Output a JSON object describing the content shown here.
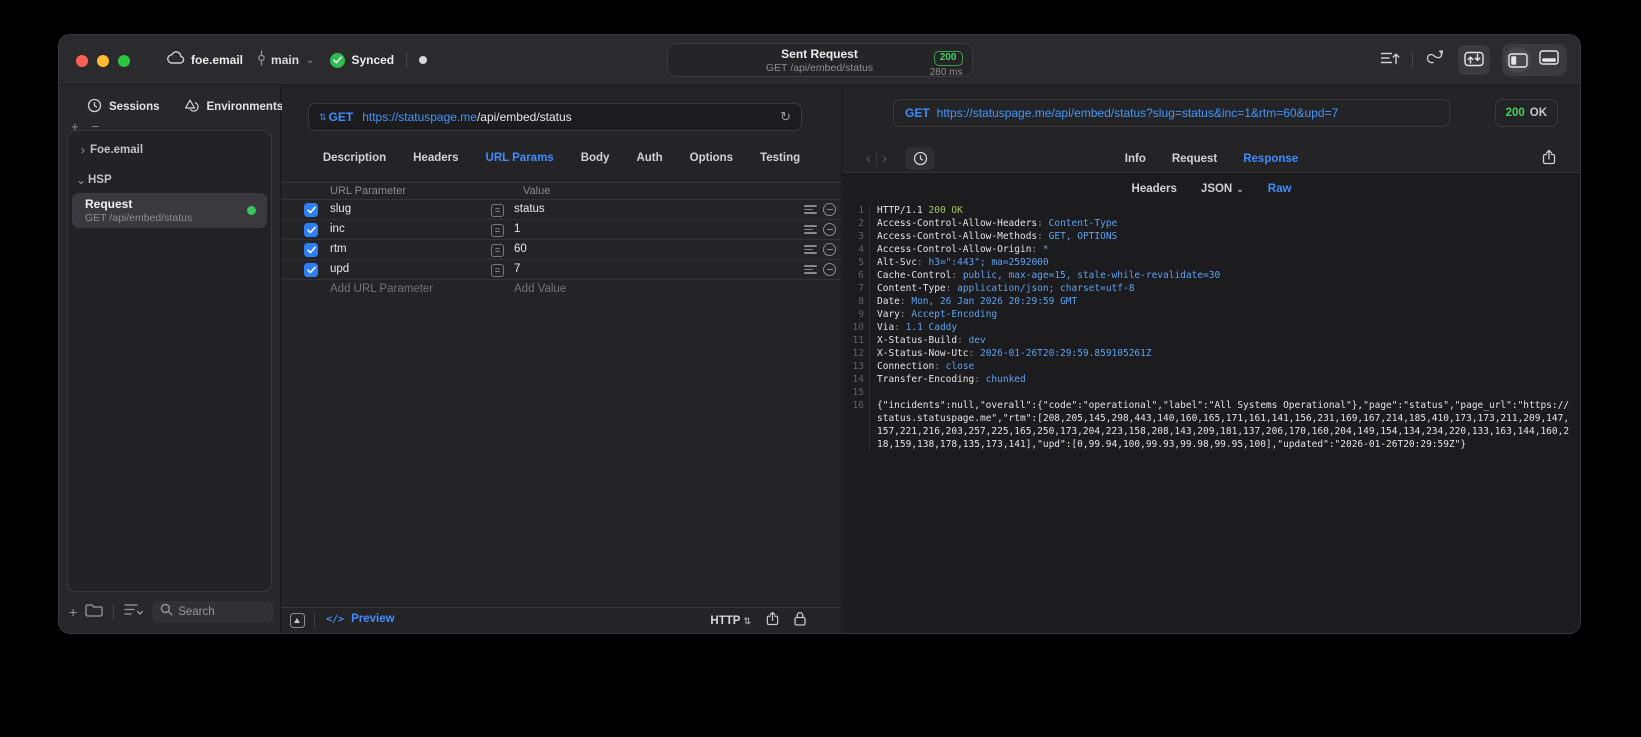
{
  "titlebar": {
    "project": "foe.email",
    "branch": "main",
    "sync_label": "Synced",
    "sent_request": {
      "title": "Sent Request",
      "subtitle": "GET /api/embed/status",
      "status_code": "200",
      "duration": "280 ms"
    }
  },
  "sidebar": {
    "tabs": [
      {
        "label": "Sessions"
      },
      {
        "label": "Environments"
      }
    ],
    "add_label": "+",
    "remove_label": "−",
    "tree": {
      "group1": "Foe.email",
      "group2": "HSP"
    },
    "request_item": {
      "title": "Request",
      "subtitle": "GET /api/embed/status"
    },
    "search_placeholder": "Search"
  },
  "request_editor": {
    "method": "GET",
    "url_host": "https://statuspage.me",
    "url_path": "/api/embed/status",
    "tabs": [
      "Description",
      "Headers",
      "URL Params",
      "Body",
      "Auth",
      "Options",
      "Testing"
    ],
    "active_tab": "URL Params",
    "params": {
      "col_name": "URL Parameter",
      "col_value": "Value",
      "rows": [
        {
          "name": "slug",
          "value": "status",
          "enabled": true
        },
        {
          "name": "inc",
          "value": "1",
          "enabled": true
        },
        {
          "name": "rtm",
          "value": "60",
          "enabled": true
        },
        {
          "name": "upd",
          "value": "7",
          "enabled": true
        }
      ],
      "add_name": "Add URL Parameter",
      "add_value": "Add Value"
    },
    "footer": {
      "code_glyph": "</>",
      "preview": "Preview",
      "protocol": "HTTP"
    }
  },
  "response_viewer": {
    "method": "GET",
    "url": "https://statuspage.me/api/embed/status?slug=status&inc=1&rtm=60&upd=7",
    "status_code": "200",
    "status_text": "OK",
    "tabs": [
      "Info",
      "Request",
      "Response"
    ],
    "active_tab": "Response",
    "subtabs": [
      "Headers",
      "JSON",
      "Raw"
    ],
    "active_subtab": "Raw",
    "http_version": "HTTP/1.1",
    "status_line": "200 OK",
    "headers": [
      {
        "name": "Access-Control-Allow-Headers",
        "value": "Content-Type"
      },
      {
        "name": "Access-Control-Allow-Methods",
        "value": "GET, OPTIONS"
      },
      {
        "name": "Access-Control-Allow-Origin",
        "value": "*"
      },
      {
        "name": "Alt-Svc",
        "value": "h3=\":443\"; ma=2592000"
      },
      {
        "name": "Cache-Control",
        "value": "public, max-age=15, stale-while-revalidate=30"
      },
      {
        "name": "Content-Type",
        "value": "application/json; charset=utf-8"
      },
      {
        "name": "Date",
        "value": "Mon, 26 Jan 2026 20:29:59 GMT"
      },
      {
        "name": "Vary",
        "value": "Accept-Encoding"
      },
      {
        "name": "Via",
        "value": "1.1 Caddy"
      },
      {
        "name": "X-Status-Build",
        "value": "dev"
      },
      {
        "name": "X-Status-Now-Utc",
        "value": "2026-01-26T20:29:59.859105261Z"
      },
      {
        "name": "Connection",
        "value": "close"
      },
      {
        "name": "Transfer-Encoding",
        "value": "chunked"
      }
    ],
    "body": "{\"incidents\":null,\"overall\":{\"code\":\"operational\",\"label\":\"All Systems Operational\"},\"page\":\"status\",\"page_url\":\"https://status.statuspage.me\",\"rtm\":[208,205,145,298,443,140,160,165,171,161,141,156,231,169,167,214,185,410,173,173,211,209,147,157,221,216,203,257,225,165,250,173,204,223,158,208,143,209,181,137,206,170,160,204,149,154,134,234,220,133,163,144,160,218,159,138,178,135,173,141],\"upd\":[0,99.94,100,99.93,99.98,99.95,100],\"updated\":\"2026-01-26T20:29:59Z\"}"
  },
  "colors": {
    "accent_blue": "#3f8cff",
    "success_green": "#32d74b",
    "code_value_blue": "#5ca2f0",
    "status_olive_green": "#9dc65e",
    "traffic_red": "#ff5f57",
    "traffic_yellow": "#febc2e",
    "traffic_green": "#28c840"
  }
}
